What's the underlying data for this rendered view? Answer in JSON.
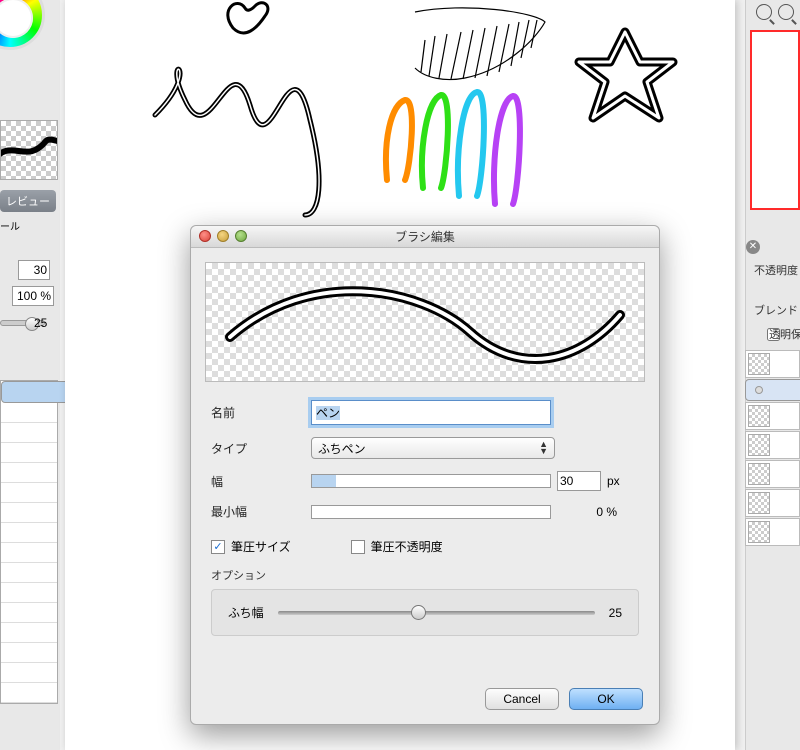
{
  "left_panel": {
    "tab_label": "レビュー",
    "sub_label": "ール",
    "width_value": "30",
    "opacity_value": "100 %",
    "inner_value": "25"
  },
  "right_panel": {
    "opacity_label": "不透明度",
    "blend_label": "ブレンド",
    "transparent_label": "透明保"
  },
  "dialog": {
    "title": "ブラシ編集",
    "labels": {
      "name": "名前",
      "type": "タイプ",
      "width": "幅",
      "min_width": "最小幅",
      "pressure_size": "筆圧サイズ",
      "pressure_opacity": "筆圧不透明度",
      "option": "オプション",
      "edge_width": "ふち幅"
    },
    "values": {
      "name": "ペン",
      "type": "ふちペン",
      "width_num": "30",
      "width_unit": "px",
      "min_width_pct": "0 %",
      "pressure_size_checked": true,
      "pressure_opacity_checked": false,
      "edge_width_val": "25"
    },
    "buttons": {
      "cancel": "Cancel",
      "ok": "OK"
    }
  }
}
